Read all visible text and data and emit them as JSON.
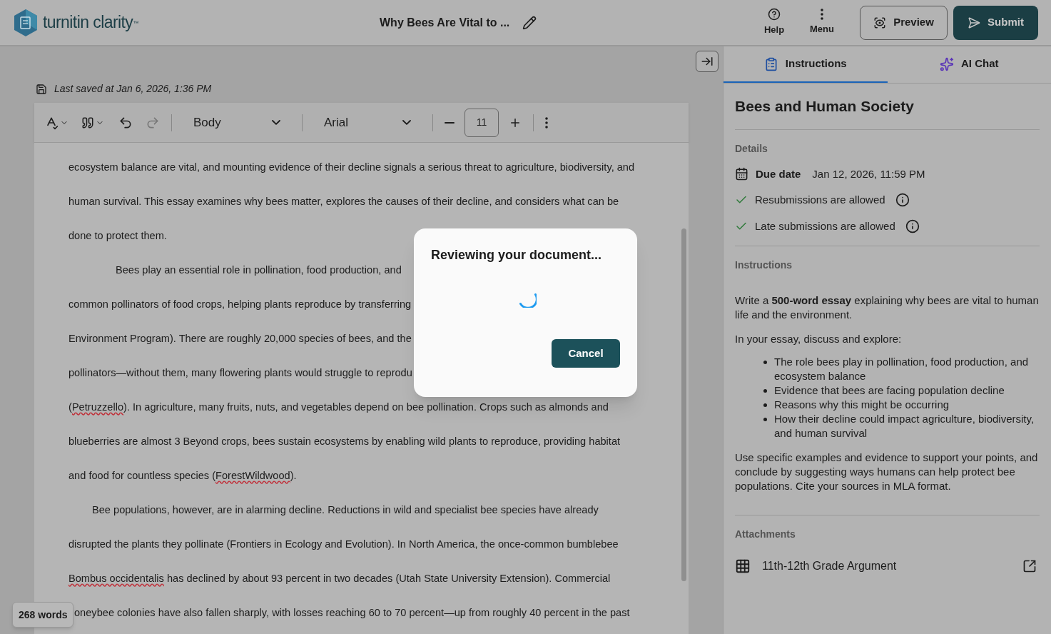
{
  "header": {
    "brand": "turnitin clarity",
    "brand_mark": "™",
    "document_title": "Why Bees Are Vital to ...",
    "help": "Help",
    "menu": "Menu",
    "preview": "Preview",
    "submit": "Submit"
  },
  "editor": {
    "last_saved": "Last saved at Jan 6, 2026, 1:36 PM",
    "toolbar": {
      "undo_disabled": false,
      "redo_disabled": true,
      "style": "Body",
      "font": "Arial",
      "size": "11"
    },
    "lines": [
      {
        "kind": "line",
        "segments": [
          {
            "text": "ecosystem balance are vital, and mounting evidence of their decline signals a serious threat to agriculture, biodiversity, and",
            "flagged": false
          }
        ]
      },
      {
        "kind": "line",
        "segments": [
          {
            "text": "human survival. This essay examines why bees matter, explores the causes of their decline, and considers what can be",
            "flagged": false
          }
        ]
      },
      {
        "kind": "line",
        "segments": [
          {
            "text": "done to protect them.",
            "flagged": false
          }
        ]
      },
      {
        "kind": "indent-wide",
        "segments": [
          {
            "text": "Bees play an essential role in pollination, food production, and",
            "flagged": false
          }
        ]
      },
      {
        "kind": "line",
        "segments": [
          {
            "text": "common pollinators of food crops, helping plants reproduce by transferring",
            "flagged": false
          }
        ]
      },
      {
        "kind": "line",
        "segments": [
          {
            "text": "Environment Program). There are roughly 20,000 species of bees, and the",
            "flagged": false
          }
        ]
      },
      {
        "kind": "line",
        "segments": [
          {
            "text": "pollinators—without them, many flowering plants would struggle to reprodu",
            "flagged": false
          }
        ]
      },
      {
        "kind": "line",
        "segments": [
          {
            "text": "(",
            "flagged": false
          },
          {
            "text": "Petruzzello",
            "flagged": true
          },
          {
            "text": "). In agriculture, many fruits, nuts, and vegetables depend on bee pollination. Crops such as almonds and",
            "flagged": false
          }
        ]
      },
      {
        "kind": "line",
        "segments": [
          {
            "text": "blueberries are almost 3 Beyond crops, bees sustain ecosystems by enabling wild plants to reproduce, providing habitat",
            "flagged": false
          }
        ]
      },
      {
        "kind": "line",
        "segments": [
          {
            "text": "and food for countless species (",
            "flagged": false
          },
          {
            "text": "ForestWildwood",
            "flagged": true
          },
          {
            "text": ").",
            "flagged": false
          }
        ]
      },
      {
        "kind": "indent",
        "segments": [
          {
            "text": "Bee populations, however, are in alarming decline. Reductions in wild and specialist bee species have already",
            "flagged": false
          }
        ]
      },
      {
        "kind": "line",
        "segments": [
          {
            "text": "disrupted the plants they pollinate (Frontiers in Ecology and Evolution). In North America, the once-common bumblebee",
            "flagged": false
          }
        ]
      },
      {
        "kind": "line",
        "segments": [
          {
            "text": "Bombus occidentalis",
            "flagged": true
          },
          {
            "text": " has declined by about 93 percent in two decades (Utah State University Extension). Commercial",
            "flagged": false
          }
        ]
      },
      {
        "kind": "line",
        "segments": [
          {
            "text": "oneybee colonies have also fallen sharply, with losses reaching 60 to 70 percent—up from roughly 40 percent in the past",
            "flagged": false
          }
        ]
      }
    ],
    "word_count": "268 words"
  },
  "dialog": {
    "title": "Reviewing your document...",
    "cancel": "Cancel"
  },
  "panel": {
    "tabs": [
      {
        "label": "Instructions",
        "selected": true
      },
      {
        "label": "AI Chat",
        "selected": false
      }
    ],
    "title": "Bees and Human Society",
    "details": {
      "heading": "Details",
      "due_label": "Due date",
      "due_value": "Jan 12, 2026, 11:59 PM",
      "rules": [
        {
          "text": "Resubmissions are allowed",
          "allowed": true
        },
        {
          "text": "Late submissions are allowed",
          "allowed": true
        }
      ]
    },
    "instructions": {
      "heading": "Instructions",
      "intro": "Write a **500-word essay** explaining why bees are vital to human life and the environment.",
      "lead": "In your essay, discuss and explore:",
      "bullets": [
        "The role bees play in pollination, food production, and ecosystem balance",
        "Evidence that bees are facing population decline",
        "Reasons why this might be occurring",
        "How their decline could impact agriculture, biodiversity, and human survival"
      ],
      "closing": "Use specific examples and evidence to support your points, and conclude by suggesting ways humans can help protect bee populations. Cite your sources in MLA format."
    },
    "attachments": {
      "heading": "Attachments",
      "items": [
        "11th-12th Grade Argument"
      ]
    }
  }
}
